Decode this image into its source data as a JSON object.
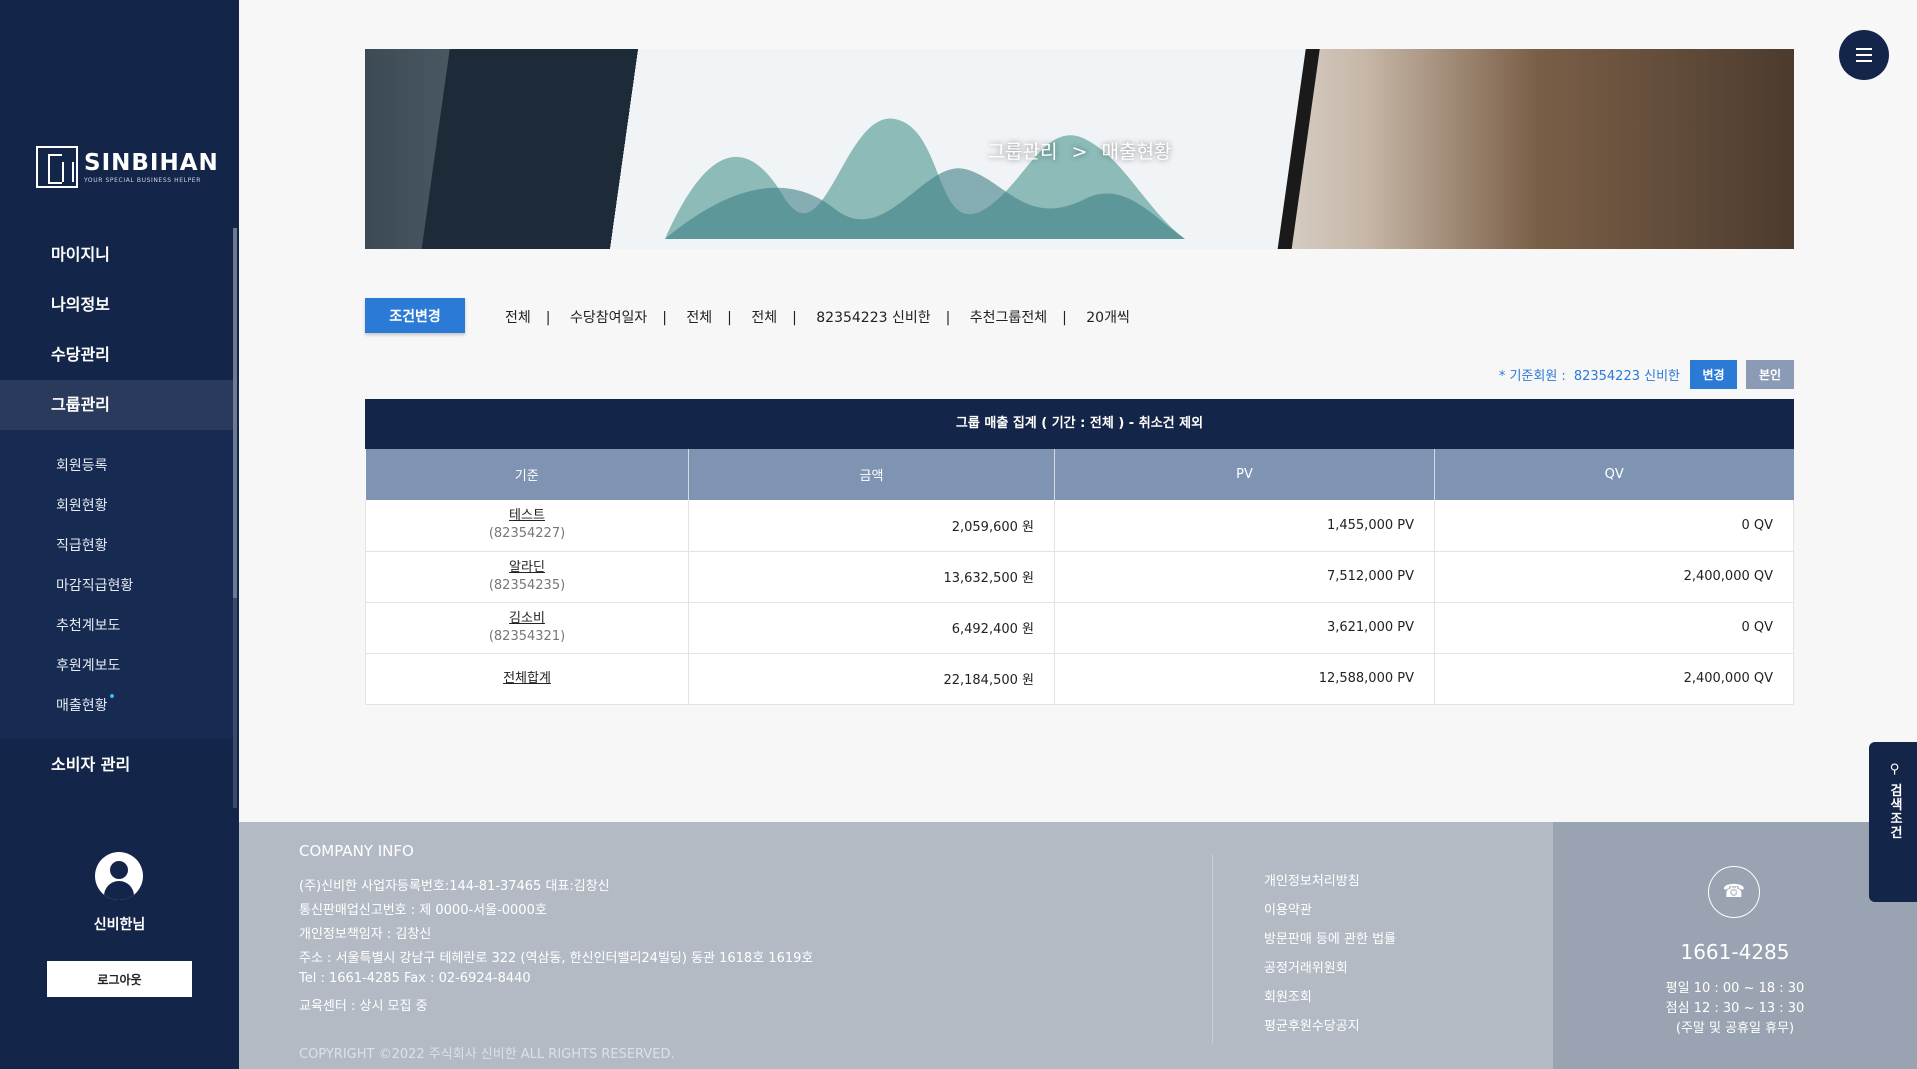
{
  "brand": {
    "name": "SINBIHAN",
    "tagline": "YOUR SPECIAL BUSINESS HELPER"
  },
  "sidebar": {
    "menu": [
      "마이지니",
      "나의정보",
      "수당관리",
      "그룹관리",
      "소비자 관리"
    ],
    "submenu": [
      "회원등록",
      "회원현황",
      "직급현황",
      "마감직급현황",
      "추천계보도",
      "후원계보도",
      "매출현황"
    ],
    "username": "신비한님",
    "logout": "로그아웃"
  },
  "banner": {
    "section": "그룹관리",
    "arrow": ">",
    "page": "매출현황"
  },
  "filter": {
    "button": "조건변경",
    "items": [
      "전체",
      "수당참여일자",
      "전체",
      "전체",
      "82354223 신비한",
      "추천그룹전체",
      "20개씩"
    ],
    "separator": "|"
  },
  "base_member": {
    "label": "* 기준회원 :",
    "value": "82354223 신비한",
    "change": "변경",
    "self": "본인"
  },
  "table": {
    "title": "그룹 매출 집계 ( 기간 : 전체 ) - 취소건 제외",
    "headers": [
      "기준",
      "금액",
      "PV",
      "QV"
    ],
    "rows": [
      {
        "name": "테스트",
        "id": "(82354227)",
        "amount": "2,059,600 원",
        "pv": "1,455,000 PV",
        "qv": "0 QV"
      },
      {
        "name": "알라딘",
        "id": "(82354235)",
        "amount": "13,632,500 원",
        "pv": "7,512,000 PV",
        "qv": "2,400,000 QV"
      },
      {
        "name": "김소비",
        "id": "(82354321)",
        "amount": "6,492,400 원",
        "pv": "3,621,000 PV",
        "qv": "0 QV"
      }
    ],
    "total": {
      "name": "전체합계",
      "amount": "22,184,500 원",
      "pv": "12,588,000 PV",
      "qv": "2,400,000 QV"
    }
  },
  "footer": {
    "title": "COMPANY INFO",
    "lines": [
      "(주)신비한    사업자등록번호:144-81-37465    대표:김창신",
      "통신판매업신고번호 : 제 0000-서울-0000호",
      "개인정보책임자 : 김창신",
      "주소 : 서울특별시 강남구 테헤란로 322 (역삼동, 한신인터밸리24빌딩) 동관 1618호 1619호",
      "Tel : 1661-4285    Fax : 02-6924-8440",
      "교육센터 : 상시 모집 중"
    ],
    "copyright": "COPYRIGHT ©2022 주식회사 신비한 ALL RIGHTS RESERVED.",
    "links": [
      "개인정보처리방침",
      "이용약관",
      "방문판매 등에 관한 법률",
      "공정거래위원회",
      "회원조회",
      "평균후원수당공지"
    ]
  },
  "contact": {
    "phone": "1661-4285",
    "hours": [
      "평일 10 : 00 ~ 18 : 30",
      "점심 12 : 30 ~ 13 : 30",
      "(주말 및 공휴일 휴무)"
    ]
  },
  "search_tab": "검색조건",
  "icons": {
    "menu": "hamburger-icon",
    "phone": "phone-icon",
    "search": "search-icon",
    "user": "user-icon"
  },
  "colors": {
    "navy": "#14254a",
    "accent": "#2b7ad6",
    "table_header": "#7f93b3"
  }
}
